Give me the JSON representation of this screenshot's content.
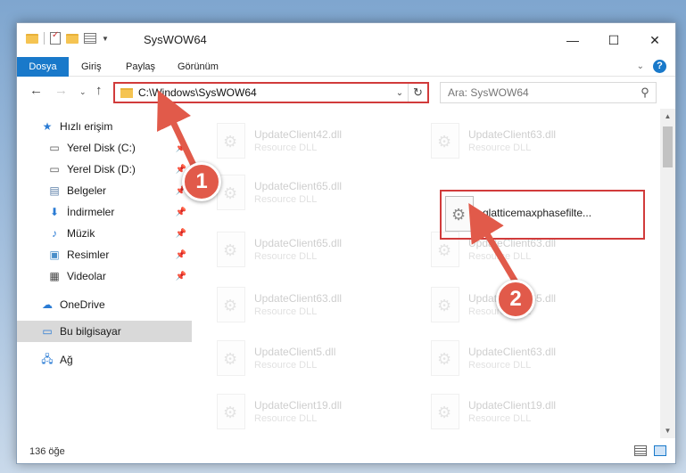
{
  "window": {
    "title": "SysWOW64",
    "controls": [
      "—",
      "☐",
      "✕"
    ]
  },
  "ribbon": {
    "tabs": [
      "Dosya",
      "Giriş",
      "Paylaş",
      "Görünüm"
    ]
  },
  "address": {
    "path": "C:\\Windows\\SysWOW64",
    "search_placeholder": "Ara: SysWOW64"
  },
  "nav": {
    "items": [
      {
        "label": "Hızlı erişim",
        "icon": "star-icon",
        "pinned": false
      },
      {
        "label": "Yerel Disk (C:)",
        "icon": "drive-icon",
        "pinned": true
      },
      {
        "label": "Yerel Disk (D:)",
        "icon": "drive-icon",
        "pinned": true
      },
      {
        "label": "Belgeler",
        "icon": "documents-icon",
        "pinned": true
      },
      {
        "label": "İndirmeler",
        "icon": "download-icon",
        "pinned": true
      },
      {
        "label": "Müzik",
        "icon": "music-icon",
        "pinned": true
      },
      {
        "label": "Resimler",
        "icon": "pictures-icon",
        "pinned": true
      },
      {
        "label": "Videolar",
        "icon": "videos-icon",
        "pinned": true
      },
      {
        "label": "OneDrive",
        "icon": "cloud-icon",
        "pinned": false
      },
      {
        "label": "Bu bilgisayar",
        "icon": "computer-icon",
        "pinned": false
      },
      {
        "label": "Ağ",
        "icon": "network-icon",
        "pinned": false
      }
    ]
  },
  "files": [
    {
      "name": "UpdateClient42.dll",
      "type": "Resource DLL"
    },
    {
      "name": "UpdateClient63.dll",
      "type": "Resource DLL"
    },
    {
      "name": "UpdateClient65.dll",
      "type": "Resource DLL"
    },
    {
      "name": "qlatticemaxphasefilte...",
      "type": ""
    },
    {
      "name": "UpdateClient65.dll",
      "type": "Resource DLL"
    },
    {
      "name": "UpdateClient63.dll",
      "type": "Resource DLL"
    },
    {
      "name": "UpdateClient63.dll",
      "type": "Resource DLL"
    },
    {
      "name": "UpdateClient65.dll",
      "type": "Resource DLL"
    },
    {
      "name": "UpdateClient5.dll",
      "type": "Resource DLL"
    },
    {
      "name": "UpdateClient63.dll",
      "type": "Resource DLL"
    },
    {
      "name": "UpdateClient19.dll",
      "type": "Resource DLL"
    },
    {
      "name": "UpdateClient19.dll",
      "type": "Resource DLL"
    }
  ],
  "status": {
    "count": "136 öğe"
  },
  "annotations": {
    "step1": "1",
    "step2": "2",
    "color": "#d13b3b"
  }
}
